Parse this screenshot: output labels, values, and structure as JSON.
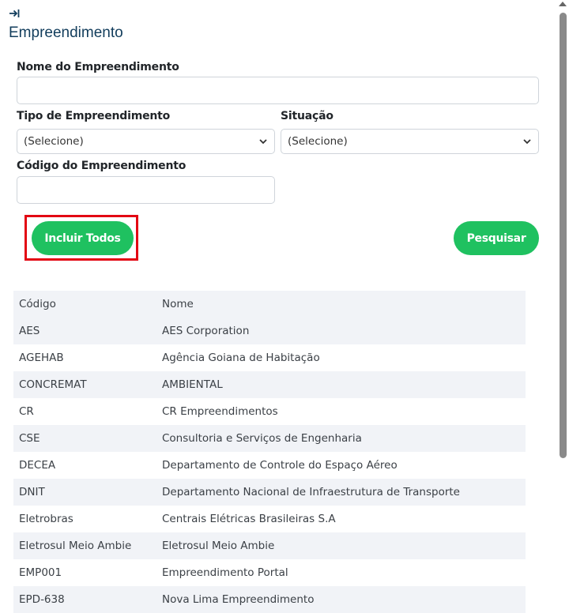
{
  "header": {
    "collapse_icon": "arrow-right-to-line-icon",
    "title": "Empreendimento"
  },
  "form": {
    "nome": {
      "label": "Nome do Empreendimento",
      "value": "",
      "placeholder": ""
    },
    "tipo": {
      "label": "Tipo de Empreendimento",
      "selected": "(Selecione)"
    },
    "situacao": {
      "label": "Situação",
      "selected": "(Selecione)"
    },
    "codigo": {
      "label": "Código do Empreendimento",
      "value": "",
      "placeholder": ""
    }
  },
  "actions": {
    "incluir_todos": "Incluir Todos",
    "pesquisar": "Pesquisar",
    "button_color": "#1fc160",
    "highlight_color": "#e30613"
  },
  "table": {
    "columns": [
      "Código",
      "Nome"
    ],
    "rows": [
      [
        "AES",
        "AES Corporation"
      ],
      [
        "AGEHAB",
        "Agência Goiana de Habitação"
      ],
      [
        "CONCREMAT",
        "AMBIENTAL"
      ],
      [
        "CR",
        "CR Empreendimentos"
      ],
      [
        "CSE",
        "Consultoria e Serviços de Engenharia"
      ],
      [
        "DECEA",
        "Departamento de Controle do Espaço Aéreo"
      ],
      [
        "DNIT",
        "Departamento Nacional de Infraestrutura de Transporte"
      ],
      [
        "Eletrobras",
        "Centrais Elétricas Brasileiras S.A"
      ],
      [
        "Eletrosul Meio Ambie",
        "Eletrosul Meio Ambie"
      ],
      [
        "EMP001",
        "Empreendimento Portal"
      ],
      [
        "EPD-638",
        "Nova Lima Empreendimento"
      ]
    ]
  }
}
